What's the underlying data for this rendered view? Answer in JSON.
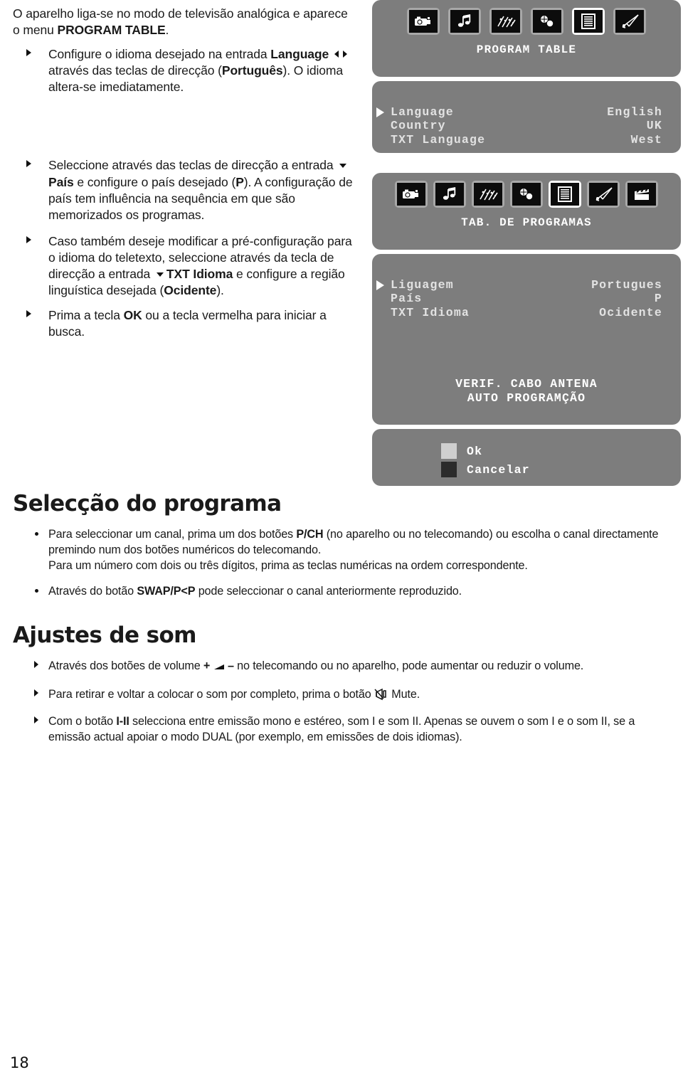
{
  "page": {
    "number": "18"
  },
  "left_column": {
    "intro": {
      "text_before_bold": "O aparelho liga-se no modo de televisão analógica e aparece o menu ",
      "bold": "PROGRAM TABLE",
      "text_after_bold": "."
    },
    "bullets": [
      {
        "p1": "Configure o idioma desejado na entrada ",
        "b1": "Language",
        "p2": " através das teclas de direcção (",
        "b2": "Português",
        "p3": "). O idioma altera-se imediatamente.",
        "icons": [
          "arrow-left-icon",
          "arrow-right-icon"
        ]
      },
      {
        "p1": "Seleccione através das teclas de direcção  a entrada ",
        "b1": "País",
        "p2": " e configure o país desejado (",
        "b2": "P",
        "p3": "). A configuração de país tem influência na sequência em que são memorizados os programas.",
        "icons": [
          "arrow-down-icon"
        ]
      },
      {
        "p1": "Caso também deseje modificar a pré-configuração para o idioma do teletexto, seleccione através da tecla de direcção a entrada ",
        "b1": "TXT Idioma",
        "p2": " e configure a região linguística desejada (",
        "b2": "Ocidente",
        "p3": ").",
        "icons": [
          "arrow-down-icon"
        ]
      },
      {
        "p1": "Prima a tecla ",
        "b1": "OK",
        "p2": " ou a tecla vermelha para iniciar a busca.",
        "b2": "",
        "p3": "",
        "icons": []
      }
    ]
  },
  "osd": {
    "colors": {
      "panel_bg": "#7d7d7d",
      "tile_bg": "#a8a8a8",
      "tile_selected_bg": "#ffffff",
      "icon_bg": "#0c0c0c",
      "text": "#e2e2e2",
      "ok_swatch": "#cfcfcf",
      "cancel_swatch": "#2b2b2b"
    },
    "panel_english": {
      "icons": [
        {
          "name": "picture-camera-icon",
          "selected": false
        },
        {
          "name": "sound-music-note-icon",
          "selected": false
        },
        {
          "name": "features-sparkles-icon",
          "selected": false
        },
        {
          "name": "settings-circles-icon",
          "selected": false
        },
        {
          "name": "program-table-list-icon",
          "selected": true
        },
        {
          "name": "install-rocket-icon",
          "selected": false
        }
      ],
      "title": "PROGRAM TABLE",
      "rows": [
        {
          "label": "Language",
          "value": "English",
          "cursor": true
        },
        {
          "label": "Country",
          "value": "UK",
          "cursor": false
        },
        {
          "label": "TXT Language",
          "value": "West",
          "cursor": false
        }
      ]
    },
    "panel_portuguese": {
      "icons": [
        {
          "name": "picture-camera-icon",
          "selected": false
        },
        {
          "name": "sound-music-note-icon",
          "selected": false
        },
        {
          "name": "features-sparkles-icon",
          "selected": false
        },
        {
          "name": "settings-circles-icon",
          "selected": false
        },
        {
          "name": "program-table-list-icon",
          "selected": true
        },
        {
          "name": "install-rocket-icon",
          "selected": false
        },
        {
          "name": "clapperboard-icon",
          "selected": false
        }
      ],
      "title": "TAB. DE PROGRAMAS",
      "rows": [
        {
          "label": "Liguagem",
          "value": "Portugues",
          "cursor": true
        },
        {
          "label": "País",
          "value": "P",
          "cursor": false
        },
        {
          "label": "TXT Idioma",
          "value": "Ocidente",
          "cursor": false
        }
      ],
      "message_line1": "VERIF. CABO ANTENA",
      "message_line2": "AUTO PROGRAMÇÃO",
      "buttons": [
        {
          "label": "Ok",
          "swatch": "ok"
        },
        {
          "label": "Cancelar",
          "swatch": "cancel"
        }
      ]
    }
  },
  "section_programa": {
    "heading": "Selecção do programa",
    "items": [
      {
        "p1": "Para seleccionar um canal, prima um dos botões ",
        "b1": "P/CH",
        "p2": " (no aparelho ou no telecomando) ou escolha o canal directamente premindo num dos botões numéricos  do telecomando.",
        "p3": "Para um número com dois ou três dígitos, prima as teclas numéricas na ordem correspondente."
      },
      {
        "p1": "Através do botão ",
        "b1": "SWAP/P<P",
        "p2": " pode seleccionar o canal anteriormente reproduzido.",
        "p3": ""
      }
    ]
  },
  "section_som": {
    "heading": "Ajustes de som",
    "items": [
      {
        "p1": "Através dos botões de volume ",
        "sym": "+ ◄ –",
        "p2": " no telecomando ou no aparelho, pode aumentar ou reduzir o volume.",
        "icons": [
          "volume-wedge-icon"
        ]
      },
      {
        "p1": "Para retirar e voltar a colocar o som por completo, prima o botão ",
        "sym": "",
        "p2": " Mute.",
        "icons": [
          "mute-speaker-icon"
        ]
      },
      {
        "p1": "Com o botão ",
        "b1": "I-II",
        "sym": "",
        "p2": " selecciona entre emissão mono e estéreo, som I e som II. Apenas se ouvem o som I e o som II, se a emissão actual apoiar o modo DUAL (por exemplo, em emissões de dois idiomas).",
        "icons": []
      }
    ]
  }
}
